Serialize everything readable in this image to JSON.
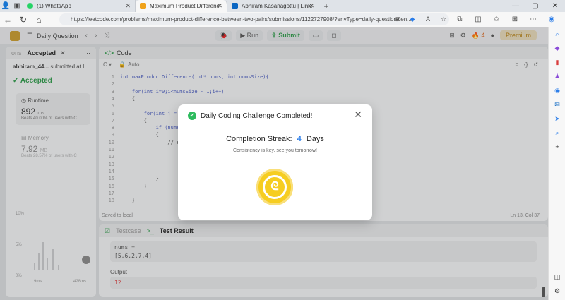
{
  "browser": {
    "tabs": [
      {
        "label": "(1) WhatsApp",
        "color": "#25d366"
      },
      {
        "label": "Maximum Product Difference Be",
        "color": "#f0a21a"
      },
      {
        "label": "Abhiram Kasanagottu | LinkedIn",
        "color": "#0a66c2"
      }
    ],
    "new_tab": "+",
    "url": "https://leetcode.com/problems/maximum-product-difference-between-two-pairs/submissions/1122727908/?envType=daily-question&en..."
  },
  "leetcode": {
    "nav_title": "Daily Question",
    "run_label": "Run",
    "submit_label": "Submit",
    "streak_count": "4",
    "premium_label": "Premium",
    "left": {
      "tab_prev": "ons",
      "tab_active": "Accepted",
      "user": "abhiram_44...",
      "submitted": "submitted at I",
      "status": "Accepted",
      "runtime_label": "Runtime",
      "runtime_value": "892",
      "runtime_unit": "ms",
      "runtime_beats": "Beats 40.00% of users with C",
      "memory_label": "Memory",
      "memory_value": "7.92",
      "memory_unit": "MB",
      "memory_beats": "Beats 28.57% of users with C",
      "axis": [
        "10%",
        "5%",
        "0%"
      ],
      "x_ticks": [
        "9ms",
        "428ms",
        "9ms",
        "428ms"
      ]
    },
    "code": {
      "tab": "Code",
      "lang": "C",
      "auto": "Auto",
      "lines": [
        "int maxProductDifference(int* nums, int numsSize){",
        "",
        "    for(int i=0;i<numsSize - 1;i++)",
        "    {",
        "",
        "        for(int j = ",
        "        {",
        "            if (nums",
        "            {",
        "                // s",
        "",
        "",
        "",
        "",
        "            }",
        "        }",
        "",
        "    }"
      ],
      "saved": "Saved to local",
      "position": "Ln 13, Col 37"
    },
    "tests": {
      "testcase_tab": "Testcase",
      "result_tab": "Test Result",
      "input_label": "nums =",
      "input_value": "[5,6,2,7,4]",
      "output_label": "Output",
      "output_value": "12"
    }
  },
  "modal": {
    "title": "Daily Coding Challenge Completed!",
    "streak_prefix": "Completion Streak:",
    "streak_num": "4",
    "streak_suffix": "Days",
    "subtitle": "Consistency is key, see you tomorrow!"
  }
}
